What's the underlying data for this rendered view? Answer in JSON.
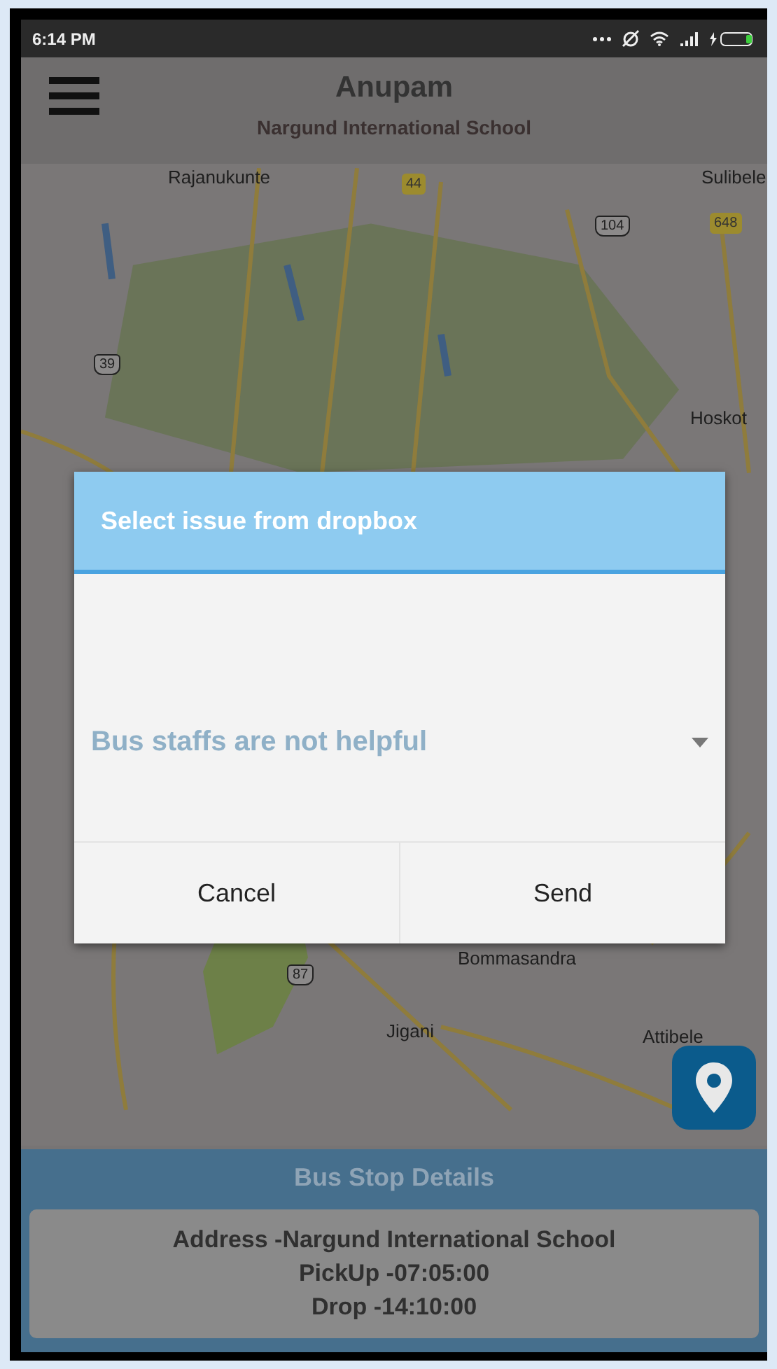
{
  "status_bar": {
    "time": "6:14 PM"
  },
  "header": {
    "title": "Anupam",
    "subtitle": "Nargund International School"
  },
  "map": {
    "labels": [
      {
        "text": "Rajanukunte",
        "kind": "place"
      },
      {
        "text": "44",
        "kind": "highway"
      },
      {
        "text": "Sulibele",
        "kind": "place"
      },
      {
        "text": "104",
        "kind": "shield"
      },
      {
        "text": "648",
        "kind": "highway"
      },
      {
        "text": "39",
        "kind": "shield"
      },
      {
        "text": "Hoskot",
        "kind": "place"
      },
      {
        "text": "87",
        "kind": "shield"
      },
      {
        "text": "Bommasandra",
        "kind": "place"
      },
      {
        "text": "Jigani",
        "kind": "place"
      },
      {
        "text": "Attibele",
        "kind": "place"
      }
    ]
  },
  "dialog": {
    "title": "Select issue from dropbox",
    "dropdown": {
      "value": "Bus staffs are not helpful"
    },
    "buttons": [
      "Cancel",
      "Send"
    ]
  },
  "bus_stop": {
    "heading": "Bus Stop Details",
    "lines": [
      "Address -Nargund International School",
      "PickUp -07:05:00",
      "Drop -14:10:00"
    ]
  }
}
